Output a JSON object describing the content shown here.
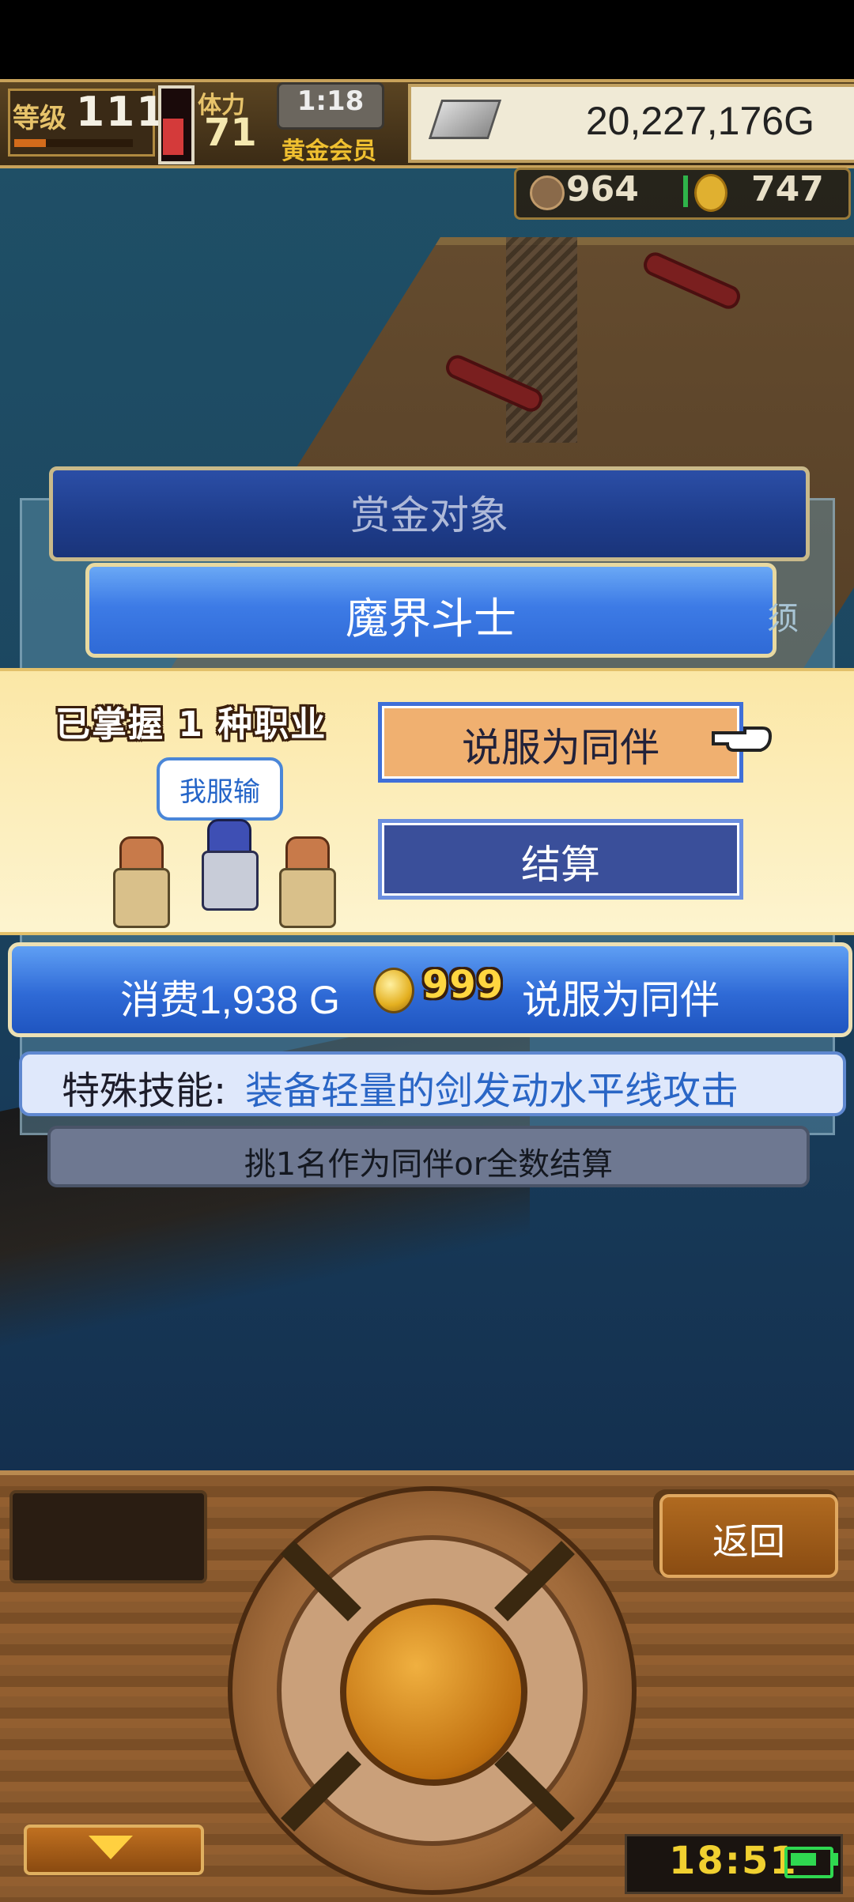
{
  "hud": {
    "level_label": "等级",
    "level": "111",
    "stamina_label": "体力",
    "stamina": "71",
    "timer": "1:18",
    "member_label": "黄金会员",
    "money": "20,227,176G",
    "resource_1": "964",
    "resource_2": "747"
  },
  "panel": {
    "title": "赏金对象",
    "target_name": "魔界斗士",
    "behind_glyph": "须"
  },
  "choice": {
    "mastered_text": "已掌握 1 种职业",
    "speech": "我服输",
    "recruit_button": "说服为同伴",
    "settle_button": "结算"
  },
  "cost": {
    "prefix": "消费1,938 G",
    "coin_count": "999",
    "suffix": "说服为同伴"
  },
  "skill": {
    "label": "特殊技能:",
    "value": "装备轻量的剑发动水平线攻击"
  },
  "hint": "挑1名作为同伴or全数结算",
  "controller": {
    "back_button": "返回",
    "clock": "18:51"
  },
  "colors": {
    "accent_blue": "#2f6ad6",
    "recruit_button": "#f0b070",
    "settle_button": "#3a4f9a",
    "cream_strip": "#fdf4cf"
  }
}
